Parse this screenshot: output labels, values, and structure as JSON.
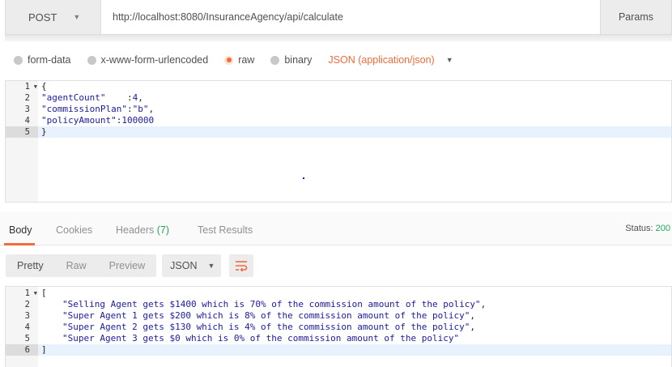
{
  "request": {
    "method": "POST",
    "url": "http://localhost:8080/InsuranceAgency/api/calculate",
    "params_label": "Params"
  },
  "body_types": [
    {
      "label": "form-data",
      "selected": false
    },
    {
      "label": "x-www-form-urlencoded",
      "selected": false
    },
    {
      "label": "raw",
      "selected": true
    },
    {
      "label": "binary",
      "selected": false
    }
  ],
  "content_type": "JSON (application/json)",
  "request_body": {
    "lines": [
      {
        "n": "1",
        "text": "{"
      },
      {
        "n": "2",
        "key": "\"agentCount\"",
        "sep": "    :",
        "val": "4",
        "end": ","
      },
      {
        "n": "3",
        "key": "\"commissionPlan\"",
        "sep": ":",
        "val": "\"b\"",
        "end": ","
      },
      {
        "n": "4",
        "key": "\"policyAmount\"",
        "sep": ":",
        "val": "100000",
        "end": ""
      },
      {
        "n": "5",
        "text": "}"
      }
    ]
  },
  "response": {
    "tabs": [
      {
        "label": "Body",
        "active": true
      },
      {
        "label": "Cookies",
        "active": false
      },
      {
        "label": "Headers",
        "count": "(7)",
        "active": false
      },
      {
        "label": "Test Results",
        "active": false
      }
    ],
    "status_label": "Status:",
    "status_value": "200",
    "views": [
      {
        "label": "Pretty",
        "active": true
      },
      {
        "label": "Raw",
        "active": false
      },
      {
        "label": "Preview",
        "active": false
      }
    ],
    "format": "JSON",
    "body_lines": [
      {
        "n": "1",
        "text": "["
      },
      {
        "n": "2",
        "text": "\"Selling Agent gets $1400 which is 70% of the commission amount of the policy\"",
        "end": ","
      },
      {
        "n": "3",
        "text": "\"Super Agent 1 gets $200 which is 8% of the commission amount of the policy\"",
        "end": ","
      },
      {
        "n": "4",
        "text": "\"Super Agent 2 gets $130 which is 4% of the commission amount of the policy\"",
        "end": ","
      },
      {
        "n": "5",
        "text": "\"Super Agent 3 gets $0 which is 0% of the commission amount of the policy\"",
        "end": ""
      },
      {
        "n": "6",
        "text": "]"
      }
    ]
  },
  "colors": {
    "accent": "#f26b3a",
    "success": "#26a65b",
    "string": "#1a1aa6"
  }
}
